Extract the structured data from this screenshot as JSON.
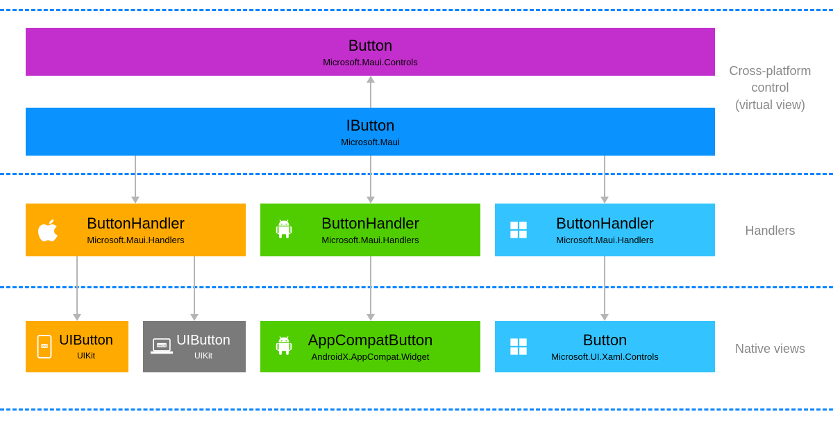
{
  "section_labels": {
    "top": "Cross-platform\ncontrol\n(virtual view)",
    "mid": "Handlers",
    "bottom": "Native views"
  },
  "top": {
    "button": {
      "title": "Button",
      "subtitle": "Microsoft.Maui.Controls"
    },
    "ibutton": {
      "title": "IButton",
      "subtitle": "Microsoft.Maui"
    }
  },
  "handlers": [
    {
      "title": "ButtonHandler",
      "subtitle": "Microsoft.Maui.Handlers"
    },
    {
      "title": "ButtonHandler",
      "subtitle": "Microsoft.Maui.Handlers"
    },
    {
      "title": "ButtonHandler",
      "subtitle": "Microsoft.Maui.Handlers"
    }
  ],
  "natives": {
    "ios": {
      "title": "UIButton",
      "subtitle": "UIKit"
    },
    "macos": {
      "title": "UIButton",
      "subtitle": "UIKit"
    },
    "android": {
      "title": "AppCompatButton",
      "subtitle": "AndroidX.AppCompat.Widget"
    },
    "windows": {
      "title": "Button",
      "subtitle": "Microsoft.UI.Xaml.Controls"
    }
  },
  "icon_badges": {
    "ios": "iOS",
    "macos": "macOS"
  }
}
